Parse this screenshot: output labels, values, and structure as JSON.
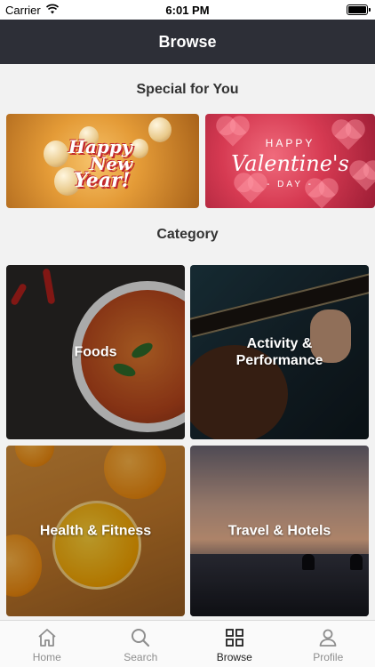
{
  "status_bar": {
    "carrier": "Carrier",
    "time": "6:01 PM",
    "wifi_icon": "wifi-icon",
    "battery_icon": "battery-icon"
  },
  "nav": {
    "title": "Browse"
  },
  "special": {
    "title": "Special for You",
    "promos": [
      {
        "line1": "Happy",
        "line2": "New",
        "line3": "Year!"
      },
      {
        "happy": "HAPPY",
        "main": "Valentine's",
        "day": "- DAY -"
      }
    ]
  },
  "category": {
    "title": "Category",
    "items": [
      {
        "label": "Foods"
      },
      {
        "label": "Activity &\nPerformance"
      },
      {
        "label": "Health & Fitness"
      },
      {
        "label": "Travel & Hotels"
      }
    ]
  },
  "tabbar": {
    "tabs": [
      {
        "label": "Home",
        "icon": "home-icon"
      },
      {
        "label": "Search",
        "icon": "search-icon"
      },
      {
        "label": "Browse",
        "icon": "grid-icon",
        "active": true
      },
      {
        "label": "Profile",
        "icon": "profile-icon"
      }
    ]
  },
  "colors": {
    "navbar_bg": "#2d2f37",
    "page_bg": "#f2f2f2",
    "tab_active": "#222222",
    "tab_inactive": "#8e8e8e"
  }
}
